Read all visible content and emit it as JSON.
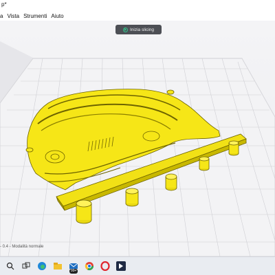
{
  "window": {
    "title": "p*"
  },
  "menu": {
    "items": [
      "a",
      "Vista",
      "Strumenti",
      "Aiuto"
    ]
  },
  "toolbar": {
    "slice_label": "Inizia slicing"
  },
  "status": {
    "text": "- 0.4 - Modalità normale"
  },
  "taskbar": {
    "apps": [
      "search-icon",
      "task-view-icon",
      "edge-icon",
      "file-explorer-icon",
      "mail-icon",
      "chrome-icon",
      "opera-icon",
      "cura-icon"
    ],
    "mail_badge": "99+"
  },
  "colors": {
    "model_yellow": "#f6e617",
    "model_outline": "#7a6f00",
    "viewport_bg": "#efeff2",
    "buildplate_grid": "#c8c8cc",
    "button_bg": "#4d4f55",
    "play_green": "#33c38b"
  }
}
